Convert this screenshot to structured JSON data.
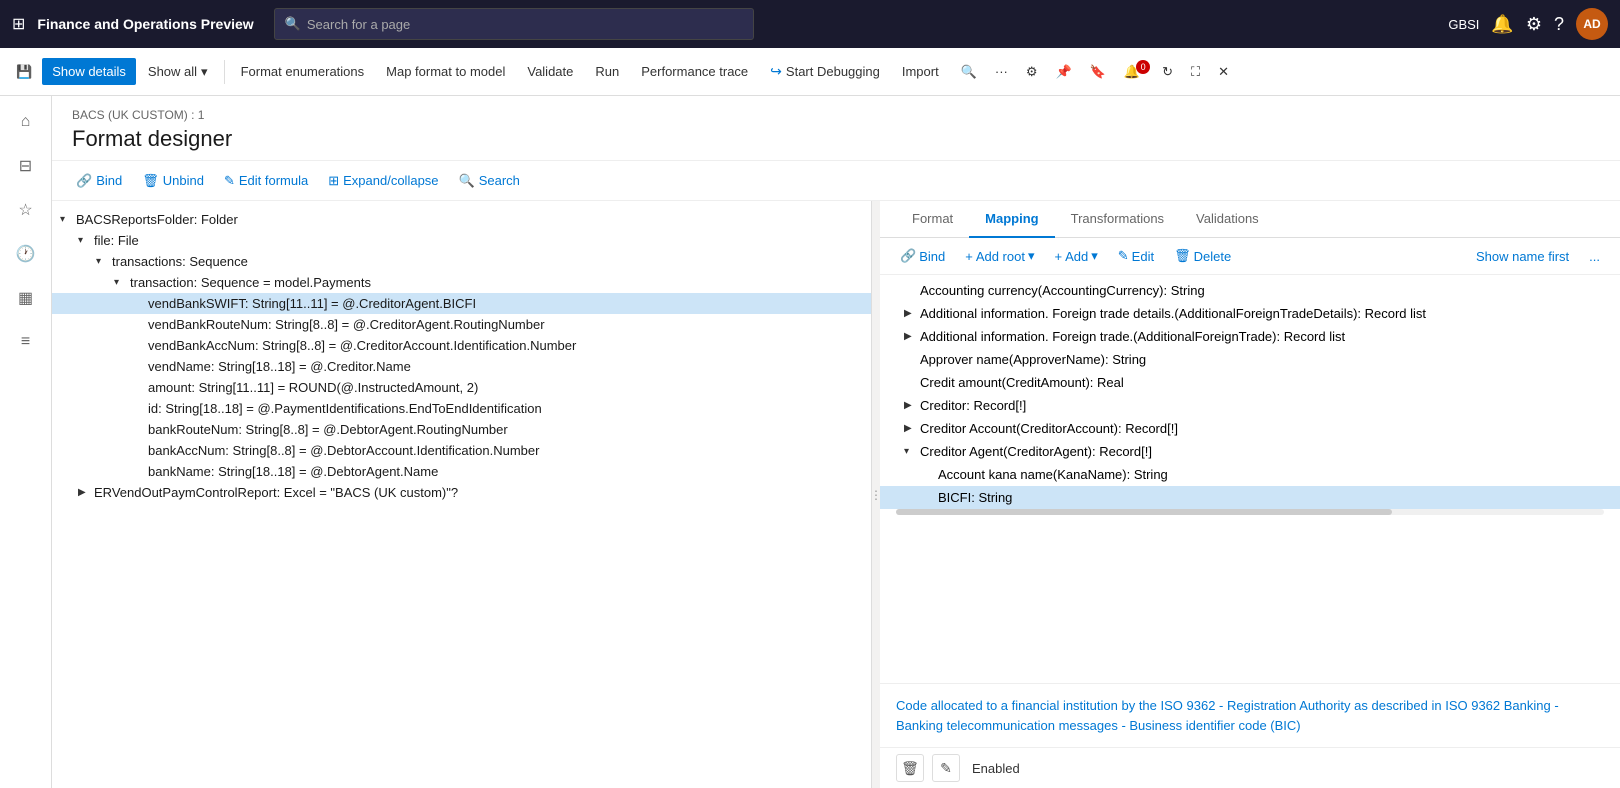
{
  "app": {
    "title": "Finance and Operations Preview",
    "search_placeholder": "Search for a page",
    "user_initials": "AD",
    "user_locale": "GBSI"
  },
  "toolbar": {
    "save_label": "Save",
    "show_details_label": "Show details",
    "show_all_label": "Show all",
    "format_enumerations_label": "Format enumerations",
    "map_format_to_model_label": "Map format to model",
    "validate_label": "Validate",
    "run_label": "Run",
    "performance_trace_label": "Performance trace",
    "start_debugging_label": "Start Debugging",
    "import_label": "Import"
  },
  "page": {
    "breadcrumb": "BACS (UK CUSTOM) : 1",
    "title": "Format designer"
  },
  "secondary_toolbar": {
    "bind_label": "Bind",
    "unbind_label": "Unbind",
    "edit_formula_label": "Edit formula",
    "expand_collapse_label": "Expand/collapse",
    "search_label": "Search"
  },
  "tree": {
    "items": [
      {
        "id": "bacs-folder",
        "indent": 0,
        "arrow": "▾",
        "label": "BACSReportsFolder: Folder",
        "selected": false
      },
      {
        "id": "file-file",
        "indent": 1,
        "arrow": "▾",
        "label": "file: File",
        "selected": false
      },
      {
        "id": "transactions-seq",
        "indent": 2,
        "arrow": "▾",
        "label": "transactions: Sequence",
        "selected": false
      },
      {
        "id": "transaction-seq",
        "indent": 3,
        "arrow": "▾",
        "label": "transaction: Sequence = model.Payments",
        "selected": false
      },
      {
        "id": "vend-bank-swift",
        "indent": 4,
        "arrow": "",
        "label": "vendBankSWIFT: String[11..11] = @.CreditorAgent.BICFI",
        "selected": true
      },
      {
        "id": "vend-bank-route",
        "indent": 4,
        "arrow": "",
        "label": "vendBankRouteNum: String[8..8] = @.CreditorAgent.RoutingNumber",
        "selected": false
      },
      {
        "id": "vend-bank-acc",
        "indent": 4,
        "arrow": "",
        "label": "vendBankAccNum: String[8..8] = @.CreditorAccount.Identification.Number",
        "selected": false
      },
      {
        "id": "vend-name",
        "indent": 4,
        "arrow": "",
        "label": "vendName: String[18..18] = @.Creditor.Name",
        "selected": false
      },
      {
        "id": "amount",
        "indent": 4,
        "arrow": "",
        "label": "amount: String[11..11] = ROUND(@.InstructedAmount, 2)",
        "selected": false
      },
      {
        "id": "id-field",
        "indent": 4,
        "arrow": "",
        "label": "id: String[18..18] = @.PaymentIdentifications.EndToEndIdentification",
        "selected": false
      },
      {
        "id": "bank-route-num",
        "indent": 4,
        "arrow": "",
        "label": "bankRouteNum: String[8..8] = @.DebtorAgent.RoutingNumber",
        "selected": false
      },
      {
        "id": "bank-acc-num",
        "indent": 4,
        "arrow": "",
        "label": "bankAccNum: String[8..8] = @.DebtorAccount.Identification.Number",
        "selected": false
      },
      {
        "id": "bank-name",
        "indent": 4,
        "arrow": "",
        "label": "bankName: String[18..18] = @.DebtorAgent.Name",
        "selected": false
      },
      {
        "id": "er-vend-out",
        "indent": 1,
        "arrow": "▶",
        "label": "ERVendOutPaymControlReport: Excel = \"BACS (UK custom)\"?",
        "selected": false
      }
    ]
  },
  "mapping": {
    "tabs": [
      "Format",
      "Mapping",
      "Transformations",
      "Validations"
    ],
    "active_tab": "Mapping",
    "toolbar": {
      "bind_label": "Bind",
      "add_root_label": "Add root",
      "add_label": "Add",
      "edit_label": "Edit",
      "delete_label": "Delete",
      "show_name_first_label": "Show name first",
      "more_label": "..."
    },
    "items": [
      {
        "id": "accounting-currency",
        "indent": 0,
        "arrow": "",
        "label": "Accounting currency(AccountingCurrency): String",
        "selected": false
      },
      {
        "id": "additional-foreign-trade-details",
        "indent": 0,
        "arrow": "▶",
        "label": "Additional information. Foreign trade details.(AdditionalForeignTradeDetails): Record list",
        "selected": false
      },
      {
        "id": "additional-foreign-trade",
        "indent": 0,
        "arrow": "▶",
        "label": "Additional information. Foreign trade.(AdditionalForeignTrade): Record list",
        "selected": false
      },
      {
        "id": "approver-name",
        "indent": 0,
        "arrow": "",
        "label": "Approver name(ApproverName): String",
        "selected": false
      },
      {
        "id": "credit-amount",
        "indent": 0,
        "arrow": "",
        "label": "Credit amount(CreditAmount): Real",
        "selected": false
      },
      {
        "id": "creditor",
        "indent": 0,
        "arrow": "▶",
        "label": "Creditor: Record[!]",
        "selected": false
      },
      {
        "id": "creditor-account",
        "indent": 0,
        "arrow": "▶",
        "label": "Creditor Account(CreditorAccount): Record[!]",
        "selected": false
      },
      {
        "id": "creditor-agent",
        "indent": 0,
        "arrow": "▾",
        "label": "Creditor Agent(CreditorAgent): Record[!]",
        "selected": false
      },
      {
        "id": "account-kana-name",
        "indent": 1,
        "arrow": "",
        "label": "Account kana name(KanaName): String",
        "selected": false
      },
      {
        "id": "bicfi",
        "indent": 1,
        "arrow": "",
        "label": "BICFI: String",
        "selected": true
      }
    ],
    "description": "Code allocated to a financial institution by the ISO 9362 - Registration Authority as described in ISO 9362 Banking - Banking telecommunication messages - Business identifier code (BIC)",
    "status": "Enabled"
  }
}
